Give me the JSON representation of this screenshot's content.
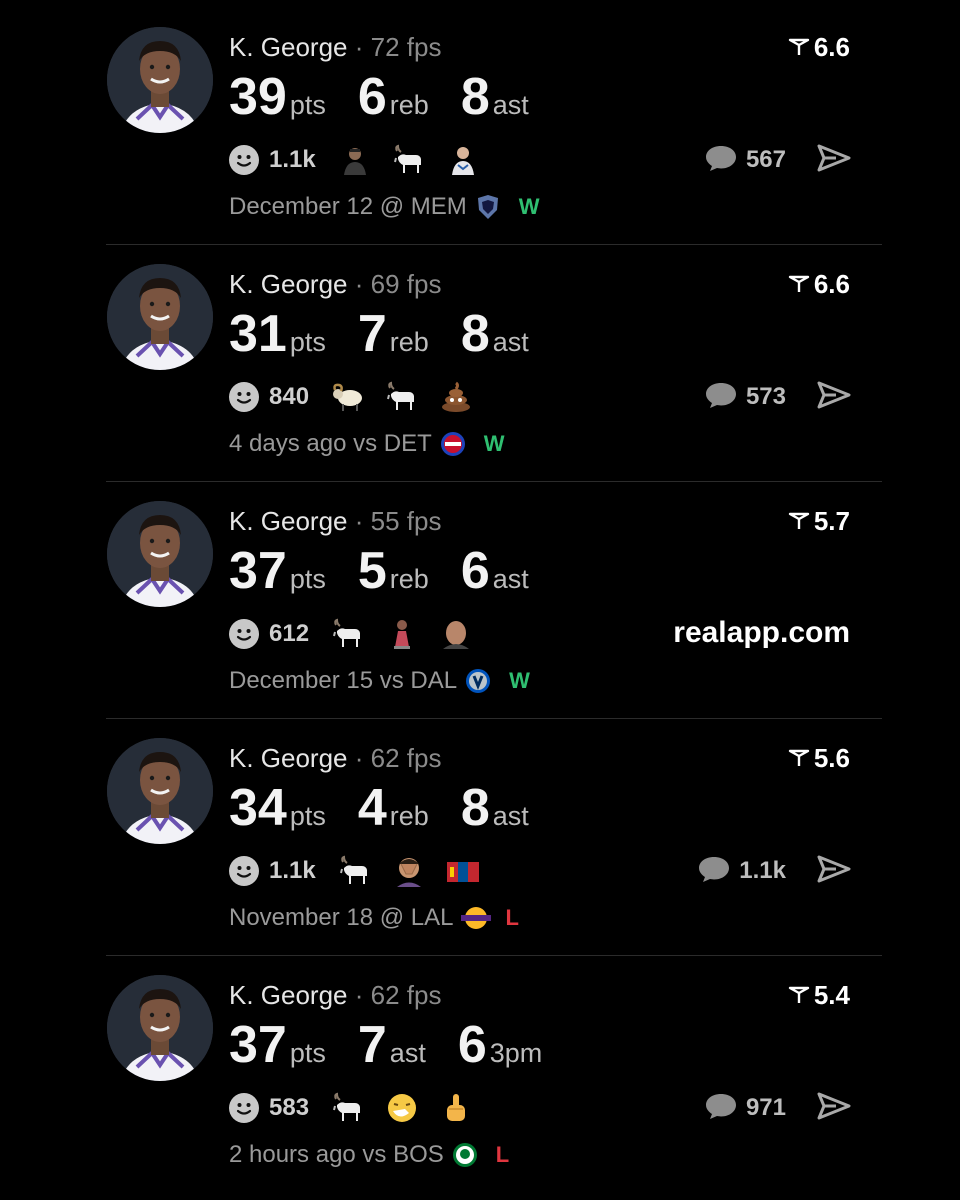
{
  "colors": {
    "win": "#2fbf71",
    "loss": "#e0363f",
    "background": "#000000"
  },
  "posts": [
    {
      "player": "K. George",
      "separator": "·",
      "fps": "72 fps",
      "score": "6.6",
      "stats": [
        {
          "value": "39",
          "unit": "pts"
        },
        {
          "value": "6",
          "unit": "reb"
        },
        {
          "value": "8",
          "unit": "ast"
        }
      ],
      "reaction_count": "1.1k",
      "emojis": [
        "person-icon",
        "goat-icon",
        "player-icon"
      ],
      "comment_count": "567",
      "date_text": "December 12 @ MEM",
      "team_icon": "grizzlies-logo-icon",
      "result": "W"
    },
    {
      "player": "K. George",
      "separator": "·",
      "fps": "69 fps",
      "score": "6.6",
      "stats": [
        {
          "value": "31",
          "unit": "pts"
        },
        {
          "value": "7",
          "unit": "reb"
        },
        {
          "value": "8",
          "unit": "ast"
        }
      ],
      "reaction_count": "840",
      "emojis": [
        "ram-icon",
        "goat-icon",
        "poop-icon"
      ],
      "comment_count": "573",
      "date_text": "4 days ago vs DET",
      "team_icon": "pistons-logo-icon",
      "result": "W"
    },
    {
      "player": "K. George",
      "separator": "·",
      "fps": "55 fps",
      "score": "5.7",
      "stats": [
        {
          "value": "37",
          "unit": "pts"
        },
        {
          "value": "5",
          "unit": "reb"
        },
        {
          "value": "6",
          "unit": "ast"
        }
      ],
      "reaction_count": "612",
      "emojis": [
        "goat-icon",
        "trophy-figure-icon",
        "face-icon"
      ],
      "watermark": "realapp.com",
      "date_text": "December 15 vs DAL",
      "team_icon": "mavericks-logo-icon",
      "result": "W"
    },
    {
      "player": "K. George",
      "separator": "·",
      "fps": "62 fps",
      "score": "5.6",
      "stats": [
        {
          "value": "34",
          "unit": "pts"
        },
        {
          "value": "4",
          "unit": "reb"
        },
        {
          "value": "8",
          "unit": "ast"
        }
      ],
      "reaction_count": "1.1k",
      "emojis": [
        "goat-icon",
        "facepalm-icon",
        "mongolia-flag-icon"
      ],
      "comment_count": "1.1k",
      "date_text": "November 18 @ LAL",
      "team_icon": "lakers-logo-icon",
      "result": "L"
    },
    {
      "player": "K. George",
      "separator": "·",
      "fps": "62 fps",
      "score": "5.4",
      "stats": [
        {
          "value": "37",
          "unit": "pts"
        },
        {
          "value": "7",
          "unit": "ast"
        },
        {
          "value": "6",
          "unit": "3pm"
        }
      ],
      "reaction_count": "583",
      "emojis": [
        "goat-icon",
        "sneezing-face-icon",
        "middle-finger-icon"
      ],
      "comment_count": "971",
      "date_text": "2 hours ago vs BOS",
      "team_icon": "celtics-logo-icon",
      "result": "L"
    }
  ]
}
